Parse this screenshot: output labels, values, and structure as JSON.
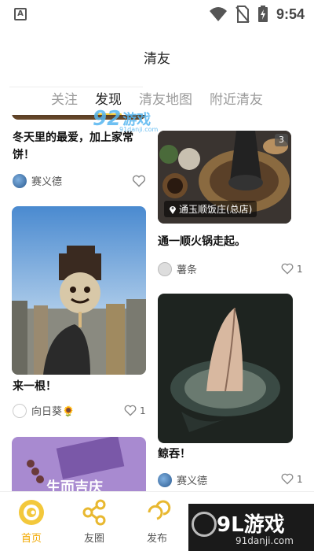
{
  "status": {
    "time": "9:54",
    "notification_icon": "A"
  },
  "header": {
    "title": "清友"
  },
  "tabs": [
    {
      "label": "关注",
      "active": false
    },
    {
      "label": "发现",
      "active": true
    },
    {
      "label": "清友地图",
      "active": false
    },
    {
      "label": "附近清友",
      "active": false
    }
  ],
  "cards": {
    "left_top": {
      "caption": "冬天里的最爱，加上家常饼！",
      "author": "赛义德",
      "likes": ""
    },
    "right_top": {
      "caption": "通一顺火锅走起。",
      "author": "薯条",
      "likes": "1",
      "location": "通玉顺饭庄(总店)",
      "image_count": "3"
    },
    "left_mid": {
      "caption": "来一根！",
      "author": "向日葵🌻",
      "likes": "1"
    },
    "right_mid": {
      "caption": "鲸吞！",
      "author": "赛义德",
      "likes": "1"
    },
    "left_bottom": {
      "overlay_text": "生而吉庆"
    }
  },
  "bottom_nav": [
    {
      "label": "首页",
      "icon": "home-swirl-icon",
      "active": true
    },
    {
      "label": "友圈",
      "icon": "share-icon",
      "active": false
    },
    {
      "label": "发布",
      "icon": "publish-swirl-icon",
      "active": false
    },
    {
      "label": "",
      "icon": "message-icon",
      "active": false
    },
    {
      "label": "",
      "icon": "profile-swirl-icon",
      "active": false
    }
  ],
  "watermarks": {
    "top_num": "92",
    "top_text": "游戏",
    "top_url": "91danji.com",
    "bottom_text": "9L游戏",
    "bottom_url": "91danji.com"
  },
  "colors": {
    "accent": "#f3c83b",
    "nav_active": "#f2a900"
  }
}
